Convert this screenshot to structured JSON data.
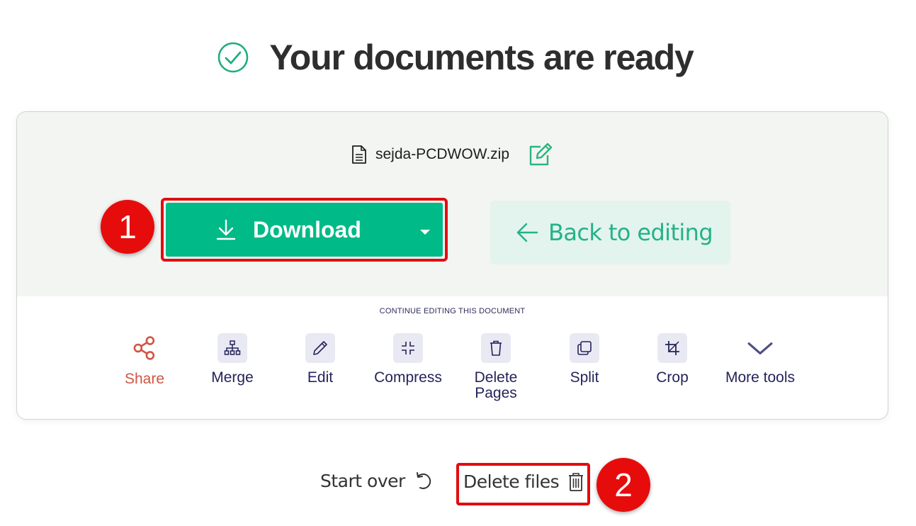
{
  "header": {
    "title": "Your documents are ready",
    "status_icon": "check-circle-icon"
  },
  "file": {
    "name": "sejda-PCDWOW.zip",
    "file_icon": "document-icon",
    "rename_icon": "edit-square-icon"
  },
  "actions": {
    "download_label": "Download",
    "download_icon": "download-arrow-icon",
    "download_menu_icon": "caret-down-icon",
    "back_label": "Back to editing",
    "back_icon": "arrow-left-icon"
  },
  "continue_section": {
    "heading": "CONTINUE EDITING THIS DOCUMENT",
    "tools": [
      {
        "label": "Share",
        "icon": "share-icon"
      },
      {
        "label": "Merge",
        "icon": "sitemap-icon"
      },
      {
        "label": "Edit",
        "icon": "pencil-icon"
      },
      {
        "label": "Compress",
        "icon": "compress-icon"
      },
      {
        "label": "Delete Pages",
        "icon": "trash-icon"
      },
      {
        "label": "Split",
        "icon": "copy-icon"
      },
      {
        "label": "Crop",
        "icon": "crop-icon"
      },
      {
        "label": "More tools",
        "icon": "chevron-down-icon"
      }
    ]
  },
  "footer": {
    "start_over_label": "Start over",
    "start_over_icon": "undo-icon",
    "delete_files_label": "Delete files",
    "delete_files_icon": "trash-icon"
  },
  "annotations": {
    "badge_1": "1",
    "badge_2": "2"
  },
  "colors": {
    "brand_green": "#00ba87",
    "back_button_bg": "#e3f3ed",
    "share_red": "#d05643",
    "tool_navy": "#24235a",
    "annotation_red": "#e60c0c"
  }
}
